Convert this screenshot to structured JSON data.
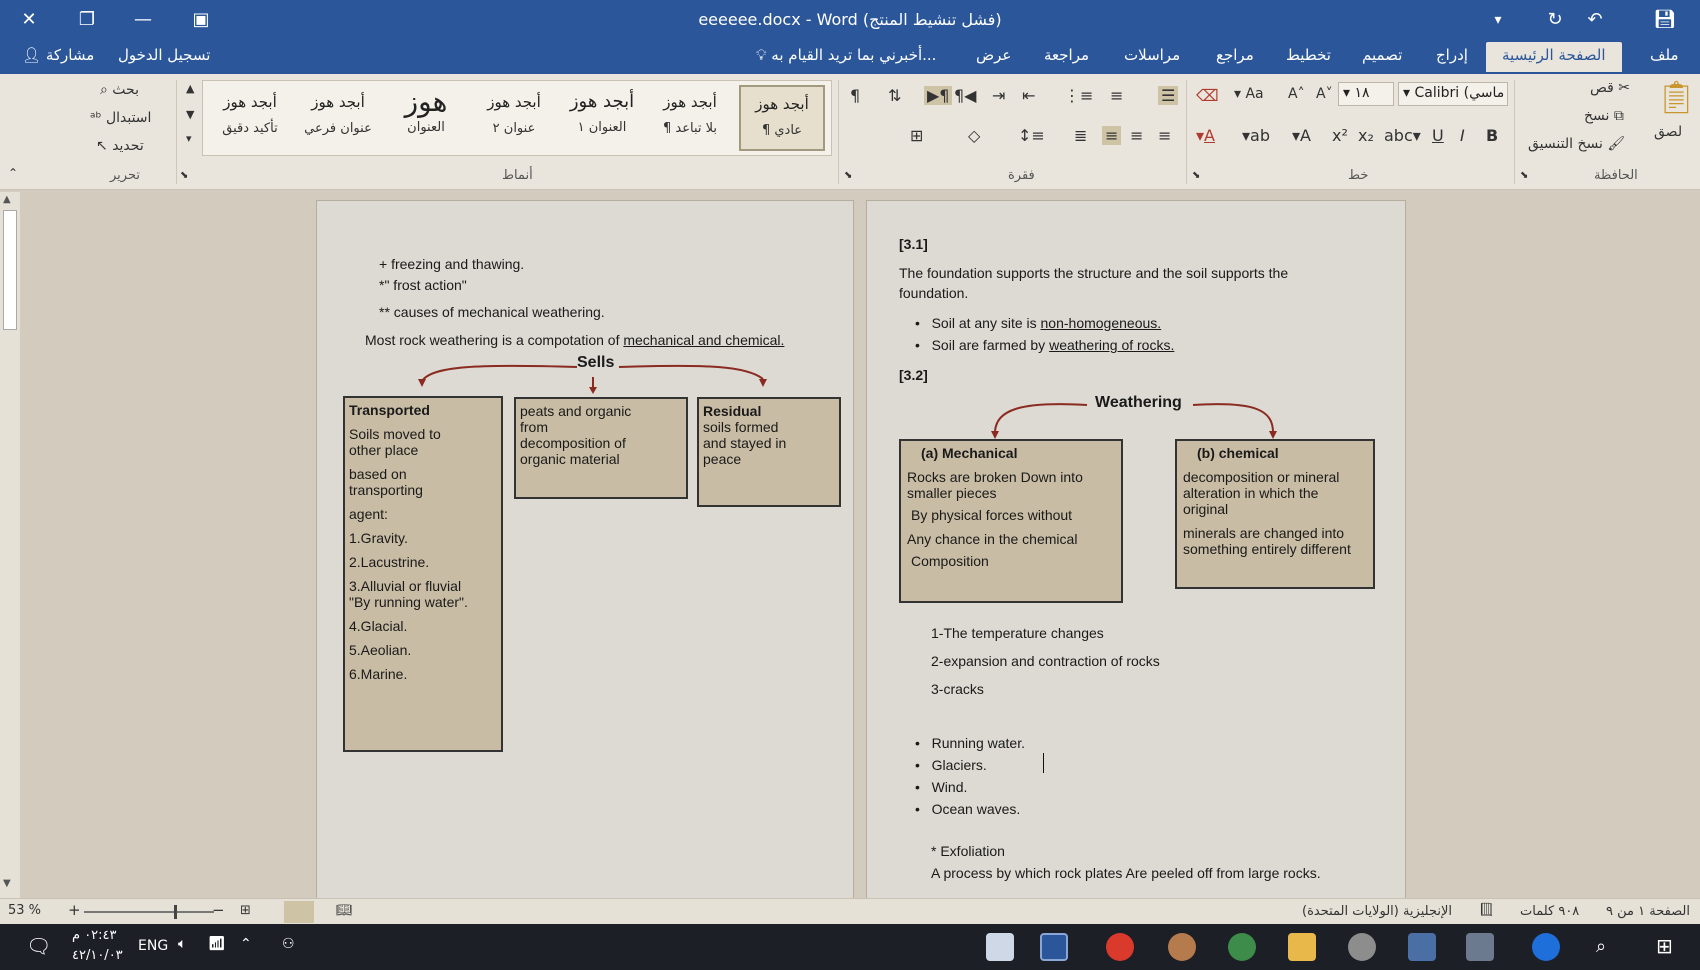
{
  "window": {
    "title": "eeeeee.docx - Word (فشل تنشيط المنتج)"
  },
  "tabs": [
    {
      "label": "ملف"
    },
    {
      "label": "الصفحة الرئيسية"
    },
    {
      "label": "إدراج"
    },
    {
      "label": "تصميم"
    },
    {
      "label": "تخطيط"
    },
    {
      "label": "مراجع"
    },
    {
      "label": "مراسلات"
    },
    {
      "label": "مراجعة"
    },
    {
      "label": "عرض"
    }
  ],
  "tellme": "أخبرني بما تريد القيام به...",
  "signin": "تسجيل الدخول",
  "share": "مشاركة",
  "ribbon": {
    "clipboard": {
      "label": "الحافظة",
      "paste": "لصق",
      "cut": "قص",
      "copy": "نسخ",
      "format_painter": "نسخ التنسيق"
    },
    "font": {
      "label": "خط",
      "name": "Calibri (ماسي",
      "size": "١٨"
    },
    "paragraph": {
      "label": "فقرة"
    },
    "styles": {
      "label": "أنماط",
      "items": [
        {
          "preview": "أبجد هوز",
          "name": "¶ عادي"
        },
        {
          "preview": "أبجد هوز",
          "name": "¶ بلا تباعد"
        },
        {
          "preview": "أبجد هوز",
          "name": "العنوان ١"
        },
        {
          "preview": "أبجد هوز",
          "name": "عنوان ٢"
        },
        {
          "preview": "هوز",
          "name": "العنوان"
        },
        {
          "preview": "أبجد هوز",
          "name": "عنوان فرعي"
        },
        {
          "preview": "أبجد هوز",
          "name": "تأكيد دقيق"
        }
      ]
    },
    "editing": {
      "label": "تحرير",
      "find": "بحث",
      "replace": "استبدال",
      "select": "تحديد"
    }
  },
  "left_page": {
    "lines": [
      "+ freezing and thawing.",
      "*\" frost action\"",
      "** causes of mechanical weathering."
    ],
    "rock_line_prefix": "Most rock weathering is a compotation of ",
    "rock_line_underlined": "mechanical and chemical.",
    "diagram_title": "Sells",
    "box_transported": [
      "Transported",
      "Soils moved to",
      "other place",
      "based on",
      "transporting",
      "agent:",
      "1.Gravity.",
      "2.Lacustrine.",
      "3.Alluvial or fluvial",
      "\"By running water\".",
      "4.Glacial.",
      "5.Aeolian.",
      "6.Marine."
    ],
    "box_peats": [
      "peats and organic",
      "from",
      "decomposition of",
      "organic material"
    ],
    "box_residual": [
      "Residual",
      "soils formed",
      "and stayed in",
      "peace"
    ]
  },
  "right_page": {
    "heading1": "[3.1]",
    "para1_a": "The foundation supports the structure and the soil supports the",
    "para1_b": "foundation.",
    "bullet1_prefix": "Soil at any site is ",
    "bullet1_u": "non-homogeneous.",
    "bullet2_prefix": "Soil are farmed by ",
    "bullet2_u": "weathering of rocks.",
    "heading2": "[3.2]",
    "diagram_title": "Weathering",
    "box_mech": [
      "(a)   Mechanical",
      "Rocks are broken Down into",
      "smaller pieces",
      "By physical forces without",
      "Any chance in the chemical",
      "Composition"
    ],
    "box_chem": [
      "(b)   chemical",
      "decomposition or mineral",
      "alteration in which the",
      "original",
      "minerals are changed into",
      "something entirely different"
    ],
    "numbered": [
      "1-The temperature changes",
      "2-expansion and contraction of rocks",
      "3-cracks"
    ],
    "bullets": [
      "Running water.",
      "Glaciers.",
      "Wind.",
      "Ocean waves."
    ],
    "exfol_title": "* Exfoliation",
    "exfol_text": "A process by which rock plates Are peeled off from large rocks."
  },
  "status": {
    "page": "الصفحة ١ من ٩",
    "words": "٩٠٨ كلمات",
    "language": "الإنجليزية (الولايات المتحدة)",
    "zoom": "53 %"
  },
  "taskbar": {
    "time": "٠٢:٤٣ م",
    "date": "٤٢/١٠/٠٣",
    "lang": "ENG"
  },
  "colors": {
    "titlebar": "#2b579a",
    "ribbon": "#e9e5dc",
    "box_fill": "#c9bca4",
    "arrow": "#8b2a20"
  }
}
